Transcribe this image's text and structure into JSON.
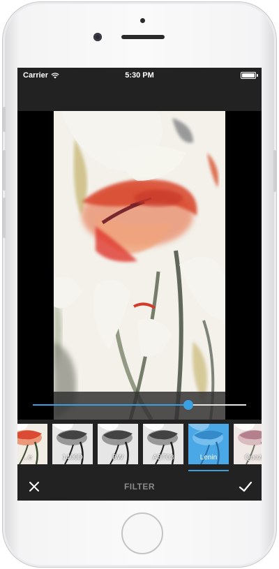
{
  "status_bar": {
    "carrier": "Carrier",
    "time": "5:30 PM",
    "wifi_icon": "wifi-icon",
    "battery_icon": "battery-icon"
  },
  "editor": {
    "intensity": 0.73
  },
  "filters": [
    {
      "label": "...e",
      "style": "color"
    },
    {
      "label": "1400D",
      "style": "mono"
    },
    {
      "label": "BW",
      "style": "mono"
    },
    {
      "label": "ABT03",
      "style": "mono"
    },
    {
      "label": "Lenin",
      "style": "blue",
      "selected": true
    },
    {
      "label": "Quozi",
      "style": "pink"
    }
  ],
  "toolbar": {
    "close_icon": "close-icon",
    "title": "FILTER",
    "done_icon": "checkmark-icon"
  },
  "colors": {
    "accent": "#3aa0e0",
    "bar_background": "#222222",
    "title_gray": "#8a8a8a"
  }
}
